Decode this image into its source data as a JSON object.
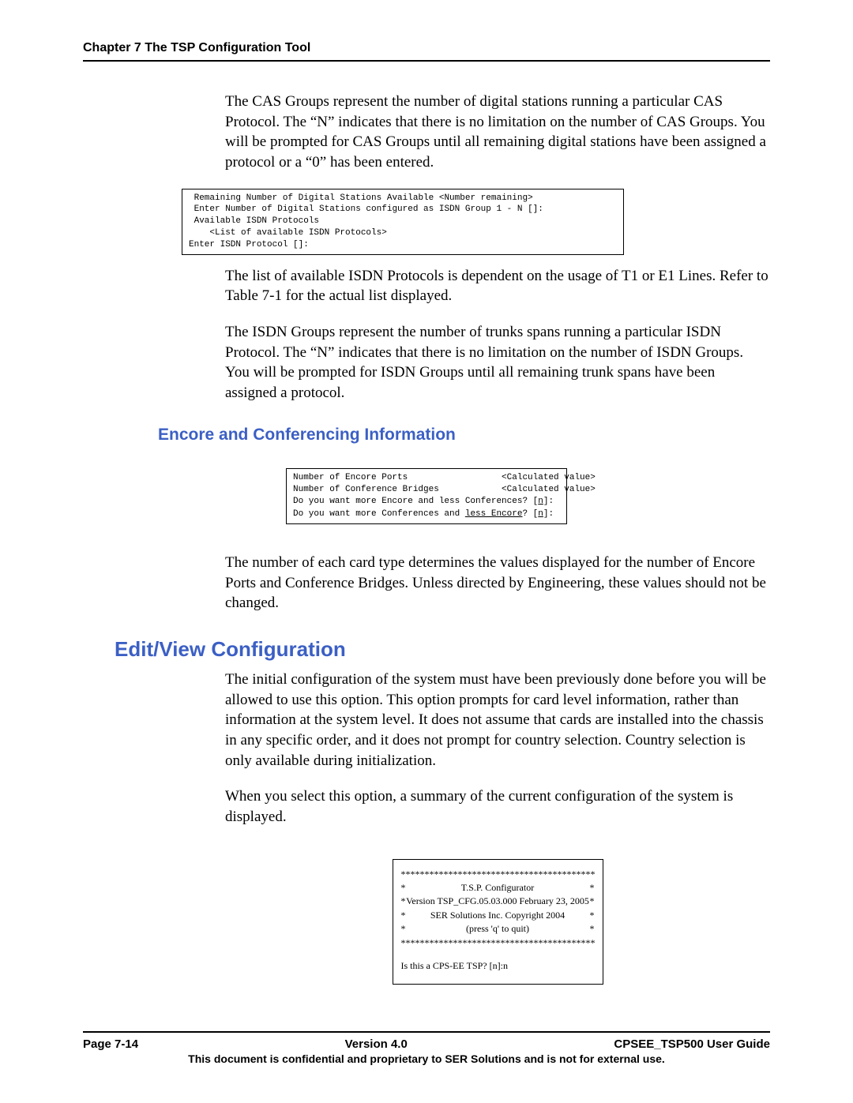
{
  "header": "Chapter 7 The TSP Configuration Tool",
  "para1": "The CAS Groups represent the number of digital stations running a particular CAS Protocol. The “N” indicates that there is no limitation on the number of CAS Groups. You will be prompted for CAS Groups until all remaining digital stations have been assigned a protocol or a “0” has been entered.",
  "code1_l1": " Remaining Number of Digital Stations Available <Number remaining>",
  "code1_l2": " Enter Number of Digital Stations configured as ISDN Group 1 - N []:",
  "code1_l3": " Available ISDN Protocols",
  "code1_l4": "    <List of available ISDN Protocols>",
  "code1_l5": "Enter ISDN Protocol []:",
  "para2": "The list of available ISDN Protocols is dependent on the usage of T1 or E1 Lines. Refer to Table 7-1 for the actual list displayed.",
  "para3": "The ISDN Groups represent the number of trunks spans running a particular ISDN Protocol. The “N” indicates that there is no limitation on the number of ISDN Groups. You will be prompted for ISDN Groups until all remaining trunk spans have been assigned a protocol.",
  "h3": "Encore and Conferencing Information",
  "code2_l1": "Number of Encore Ports                  <Calculated value>",
  "code2_l2": "Number of Conference Bridges            <Calculated value>",
  "code2_l3a": "Do you want more Encore and less Conferences? [",
  "code2_l3b": "n",
  "code2_l3c": "]:",
  "code2_l4a": "Do you want more Conferences and ",
  "code2_l4b": "less Encore",
  "code2_l4c": "? [",
  "code2_l4d": "n",
  "code2_l4e": "]:",
  "para4": "The number of each card type determines the values displayed for the number of Encore Ports and Conference Bridges.  Unless directed by Engineering, these values should not be changed.",
  "h2": "Edit/View Configuration",
  "para5": "The initial configuration of the system must have been previously done before you will be allowed to use this option. This option prompts for card level information, rather than information at the system level. It does not assume that cards are installed into the chassis in any specific order, and it does not prompt for country selection. Country selection is only available during initialization.",
  "para6": "When you select this option, a summary of the current configuration of the system is displayed.",
  "box3": {
    "stars": "******************************************************************",
    "r1": "T.S.P. Configurator",
    "r2": "Version TSP_CFG.05.03.000    February 23, 2005",
    "r3": "SER Solutions Inc. Copyright 2004",
    "r4": "(press 'q' to quit)",
    "prompt": "Is this a CPS-EE TSP? [n]:n"
  },
  "footer": {
    "left": "Page 7-14",
    "center": "Version 4.0",
    "right": "CPSEE_TSP500 User Guide",
    "bottom": "This document is confidential and proprietary to SER Solutions and is not for external use."
  }
}
